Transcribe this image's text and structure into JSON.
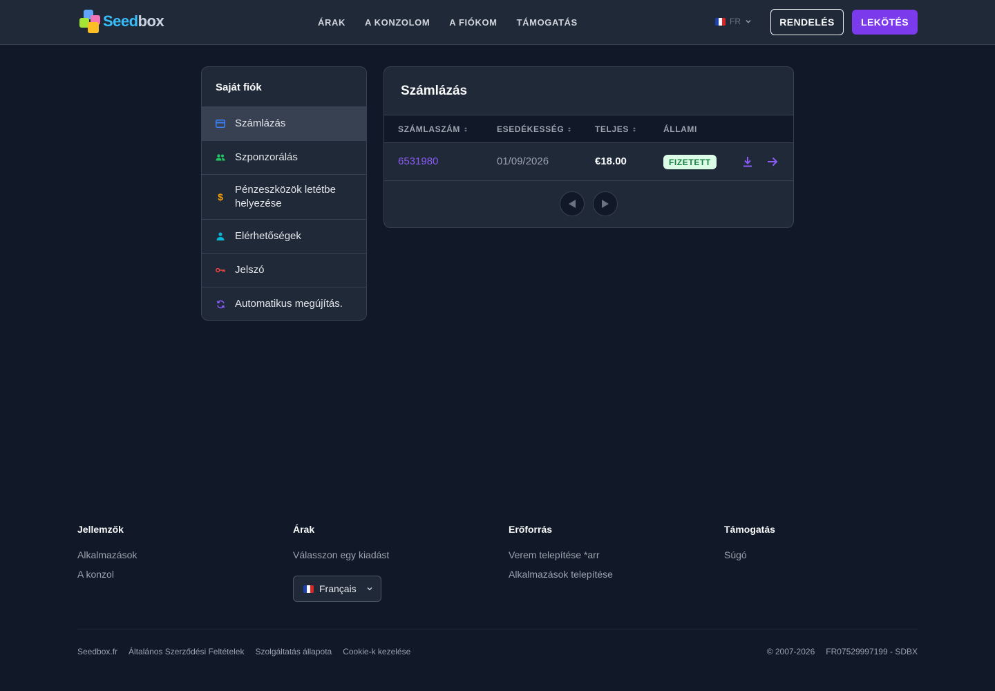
{
  "header": {
    "logo_text_a": "Seed",
    "logo_text_b": "box",
    "nav": [
      "ÁRAK",
      "A KONZOLOM",
      "A FIÓKOM",
      "TÁMOGATÁS"
    ],
    "language": "FR",
    "order_button": "RENDELÉS",
    "subscribe_button": "LEKÖTÉS"
  },
  "sidebar": {
    "title": "Saját fiók",
    "items": [
      {
        "label": "Számlázás",
        "icon": "credit-card-icon",
        "color": "#3b82f6",
        "active": true
      },
      {
        "label": "Szponzorálás",
        "icon": "users-icon",
        "color": "#22c55e",
        "active": false
      },
      {
        "label": "Pénzeszközök letétbe helyezése",
        "icon": "dollar-icon",
        "color": "#f59e0b",
        "active": false
      },
      {
        "label": "Elérhetőségek",
        "icon": "user-icon",
        "color": "#06b6d4",
        "active": false
      },
      {
        "label": "Jelszó",
        "icon": "key-icon",
        "color": "#ef4444",
        "active": false
      },
      {
        "label": "Automatikus megújítás.",
        "icon": "refresh-icon",
        "color": "#8b5cf6",
        "active": false
      }
    ]
  },
  "billing": {
    "title": "Számlázás",
    "columns": [
      "SZÁMLASZÁM",
      "ESEDÉKESSÉG",
      "TELJES",
      "ÁLLAMI"
    ],
    "rows": [
      {
        "invoice": "6531980",
        "due": "01/09/2026",
        "total": "€18.00",
        "status": "FIZETETT"
      }
    ]
  },
  "footer": {
    "columns": [
      {
        "title": "Jellemzők",
        "links": [
          "Alkalmazások",
          "A konzol"
        ]
      },
      {
        "title": "Árak",
        "links": [
          "Válasszon egy kiadást"
        ]
      },
      {
        "title": "Erőforrás",
        "links": [
          "Verem telepítése *arr",
          "Alkalmazások telepítése"
        ]
      },
      {
        "title": "Támogatás",
        "links": [
          "Súgó"
        ]
      }
    ],
    "language_select": "Français",
    "bottom_links": [
      "Seedbox.fr",
      "Általános Szerződési Feltételek",
      "Szolgáltatás állapota",
      "Cookie-k kezelése"
    ],
    "copyright": "© 2007-2026",
    "company_id": "FR07529997199 - SDBX"
  },
  "colors": {
    "accent": "#7c3aed",
    "link": "#8b5cf6",
    "paid_bg": "#dcfce7",
    "paid_text": "#15803d"
  }
}
